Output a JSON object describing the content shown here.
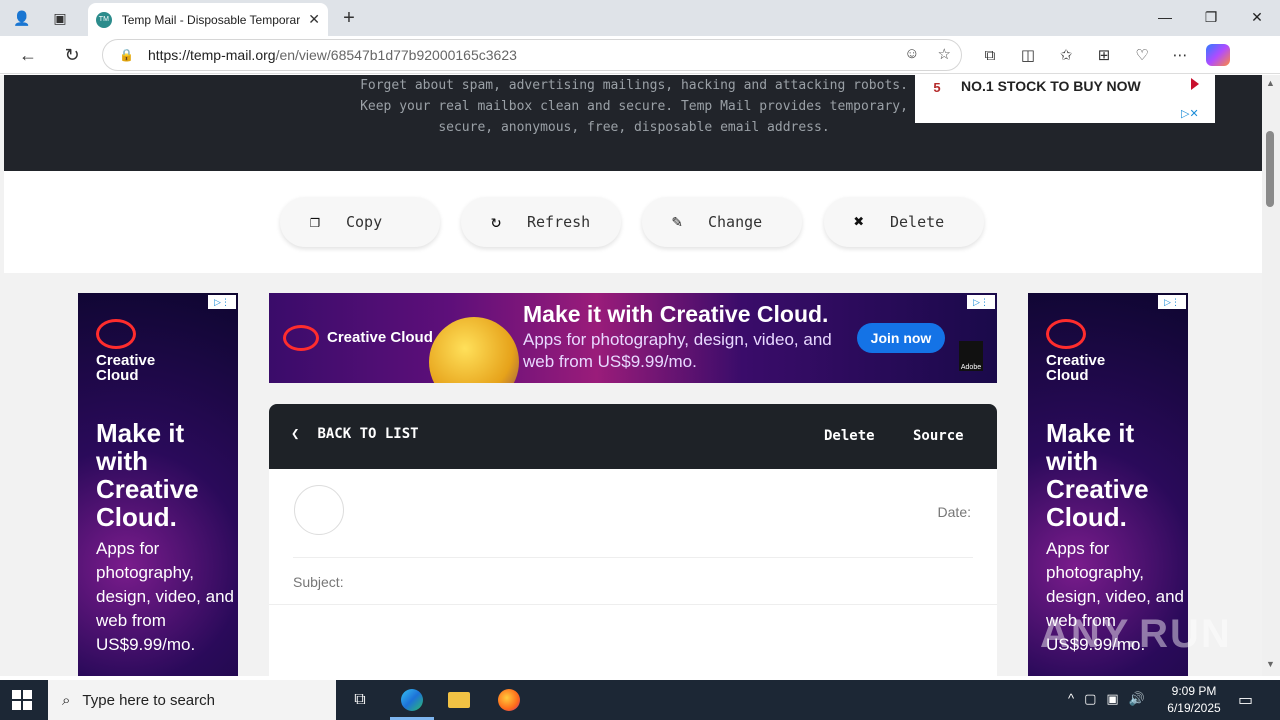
{
  "browser": {
    "tab_title": "Temp Mail - Disposable Temporar",
    "url_domain": "https://temp-mail.org",
    "url_path": "/en/view/68547b1d77b92000165c3623"
  },
  "hero": {
    "line1": "Forget about spam, advertising mailings, hacking and attacking robots.",
    "line2": "Keep your real mailbox clean and secure. Temp Mail provides temporary,",
    "line3": "secure, anonymous, free, disposable email address."
  },
  "stock_ad": {
    "number": "5",
    "text": "NO.1 STOCK TO BUY NOW"
  },
  "actions": {
    "copy": "Copy",
    "refresh": "Refresh",
    "change": "Change",
    "delete": "Delete"
  },
  "side_ad": {
    "brand_line1": "Creative",
    "brand_line2": "Cloud",
    "headline": "Make it with Creative Cloud.",
    "body": "Apps for photography, design, video, and web from US$9.99/mo."
  },
  "banner_ad": {
    "brand": "Creative Cloud",
    "headline": "Make it with Creative Cloud.",
    "body": "Apps for photography, design, video, and web from US$9.99/mo.",
    "cta": "Join now",
    "logo_text": "Adobe"
  },
  "mail": {
    "back_label": "BACK TO LIST",
    "delete_label": "Delete",
    "source_label": "Source",
    "date_label": "Date:",
    "subject_label": "Subject:"
  },
  "watermark": "ANY.RUN",
  "taskbar": {
    "search_placeholder": "Type here to search",
    "time": "9:09 PM",
    "date": "6/19/2025"
  }
}
